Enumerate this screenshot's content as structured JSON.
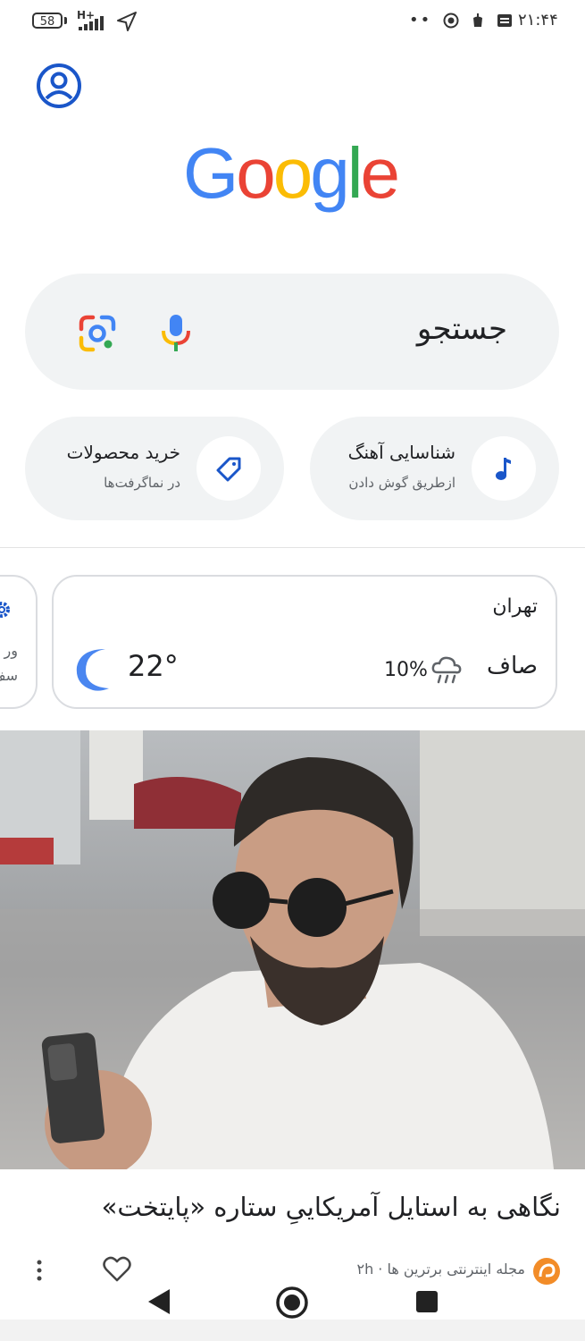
{
  "status_bar": {
    "battery": "58",
    "network": "H+",
    "dots": "••",
    "time": "۲۱:۴۴"
  },
  "logo": {
    "letters": [
      "G",
      "o",
      "o",
      "g",
      "l",
      "e"
    ],
    "colors": [
      "#4285F4",
      "#EA4335",
      "#FBBC05",
      "#4285F4",
      "#34A853",
      "#EA4335"
    ]
  },
  "search": {
    "placeholder": "جستجو"
  },
  "chips": {
    "music": {
      "title": "شناسایی آهنگ",
      "subtitle": "ازطریق گوش دادن"
    },
    "shopping": {
      "title": "خرید محصولات",
      "subtitle": "در نماگرفت‌ها"
    }
  },
  "weather": {
    "city": "تهران",
    "condition": "صاف",
    "precipitation": "10%",
    "temperature": "22°"
  },
  "side_card": {
    "line1": "ور",
    "line2": "سف"
  },
  "article": {
    "title": "نگاهی به استایل آمریکاییِ ستاره «پایتخت»",
    "source": "مجله اینترنتی برترین ها · ۲h"
  },
  "colors": {
    "accent": "#1a56c9",
    "chip_bg": "#f1f3f4"
  }
}
